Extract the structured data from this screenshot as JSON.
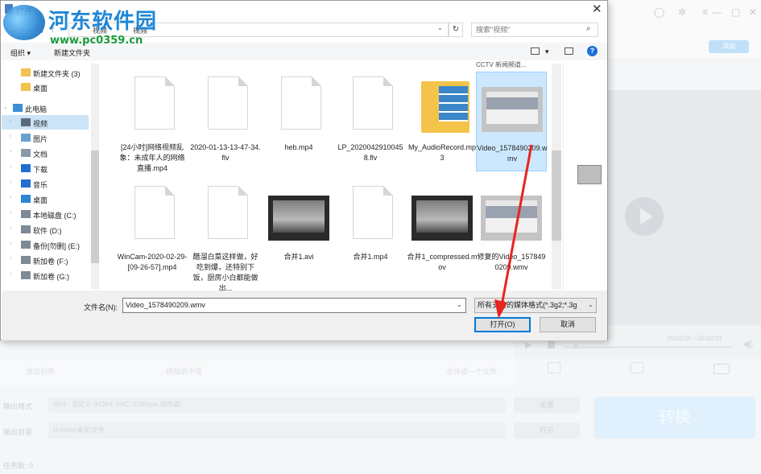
{
  "background_app": {
    "add_button": "添加",
    "timecode": "00:00:00 / 00:00:01",
    "toolbar": {
      "item1": "添加列表",
      "item2": "移除选中项",
      "item3": "合并成一个文件"
    },
    "output_format_label": "输出格式:",
    "output_format_value": "MP4 - 自定义 (H.264; AAC, 128Kbps 双声道)",
    "settings_button": "设置",
    "output_dir_label": "输出目录:",
    "output_dir_value": "D:\\tools\\桌面\\文件",
    "open_button": "打开",
    "convert_button": "转换",
    "task_count": "任务数: 0"
  },
  "dialog": {
    "title": "打开",
    "address": {
      "seg1": "视频",
      "seg2": "视频"
    },
    "search_placeholder": "搜索\"视频\"",
    "toolbar": {
      "organize": "组织 ▾",
      "new_folder": "新建文件夹"
    },
    "nav": [
      {
        "label": "新建文件夹 (3)",
        "icon": "folder-icon"
      },
      {
        "label": "桌面",
        "icon": "folder-icon"
      },
      {
        "label": "此电脑",
        "icon": "computer-icon"
      },
      {
        "label": "视频",
        "icon": "video-folder-icon"
      },
      {
        "label": "图片",
        "icon": "pictures-icon"
      },
      {
        "label": "文档",
        "icon": "documents-icon"
      },
      {
        "label": "下载",
        "icon": "download-icon"
      },
      {
        "label": "音乐",
        "icon": "music-icon"
      },
      {
        "label": "桌面",
        "icon": "desktop-icon"
      },
      {
        "label": "本地磁盘 (C:)",
        "icon": "drive-icon"
      },
      {
        "label": "软件 (D:)",
        "icon": "drive-icon"
      },
      {
        "label": "备份[勿删] (E:)",
        "icon": "drive-icon"
      },
      {
        "label": "新加卷 (F:)",
        "icon": "drive-icon"
      },
      {
        "label": "新加卷 (G:)",
        "icon": "drive-icon"
      }
    ],
    "partial_top_item": "CCTV 新闻频道...",
    "files": [
      {
        "name": "[24小时]网络视频乱象：未成年人的网络直播.mp4"
      },
      {
        "name": "2020-01-13-13-47-34.flv"
      },
      {
        "name": "heb.mp4"
      },
      {
        "name": "LP_20200429100458.flv"
      },
      {
        "name": "My_AudioRecord.mp3"
      },
      {
        "name": "Video_1578490209.wmv"
      },
      {
        "name": "WinCam-2020-02-29-[09-26-57].mp4"
      },
      {
        "name": "醋溜白菜这样做，好吃到爆，还特别下饭，厨房小白都能做出..."
      },
      {
        "name": "合并1.avi"
      },
      {
        "name": "合并1.mp4"
      },
      {
        "name": "合并1_compressed.mov"
      },
      {
        "name": "修复的Video_1578490209.wmv"
      }
    ],
    "filename_label": "文件名(N):",
    "filename_value": "Video_1578490209.wmv",
    "filetype_value": "所有支持的媒体格式(*.3g2;*.3g",
    "open_button": "打开(O)",
    "cancel_button": "取消"
  },
  "watermark": {
    "title": "河东软件园",
    "url": "www.pc0359.cn"
  },
  "colors": {
    "selection": "#cce8ff",
    "accent": "#0078d7",
    "arrow": "#e8241e"
  }
}
